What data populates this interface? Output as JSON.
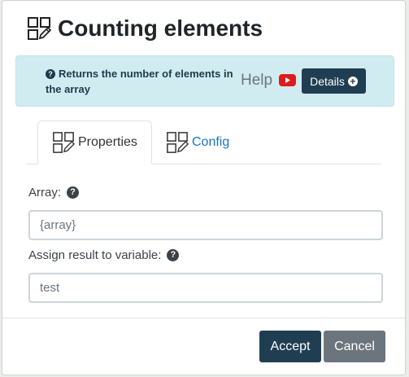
{
  "dialog": {
    "title": "Counting elements",
    "icon": "edit-grid-icon"
  },
  "info": {
    "text": "Returns the number of elements in the array",
    "help_label": "Help",
    "details_label": "Details",
    "youtube_icon": "youtube-icon"
  },
  "tabs": [
    {
      "label": "Properties",
      "active": true
    },
    {
      "label": "Config",
      "active": false
    }
  ],
  "fields": {
    "array": {
      "label": "Array:",
      "value": "{array}"
    },
    "assign": {
      "label": "Assign result to variable:",
      "value": "test"
    }
  },
  "footer": {
    "accept_label": "Accept",
    "cancel_label": "Cancel"
  },
  "colors": {
    "primary": "#1f3e52",
    "secondary": "#6c757d",
    "info_bg": "#d1ecf1",
    "link": "#1a73c8"
  }
}
